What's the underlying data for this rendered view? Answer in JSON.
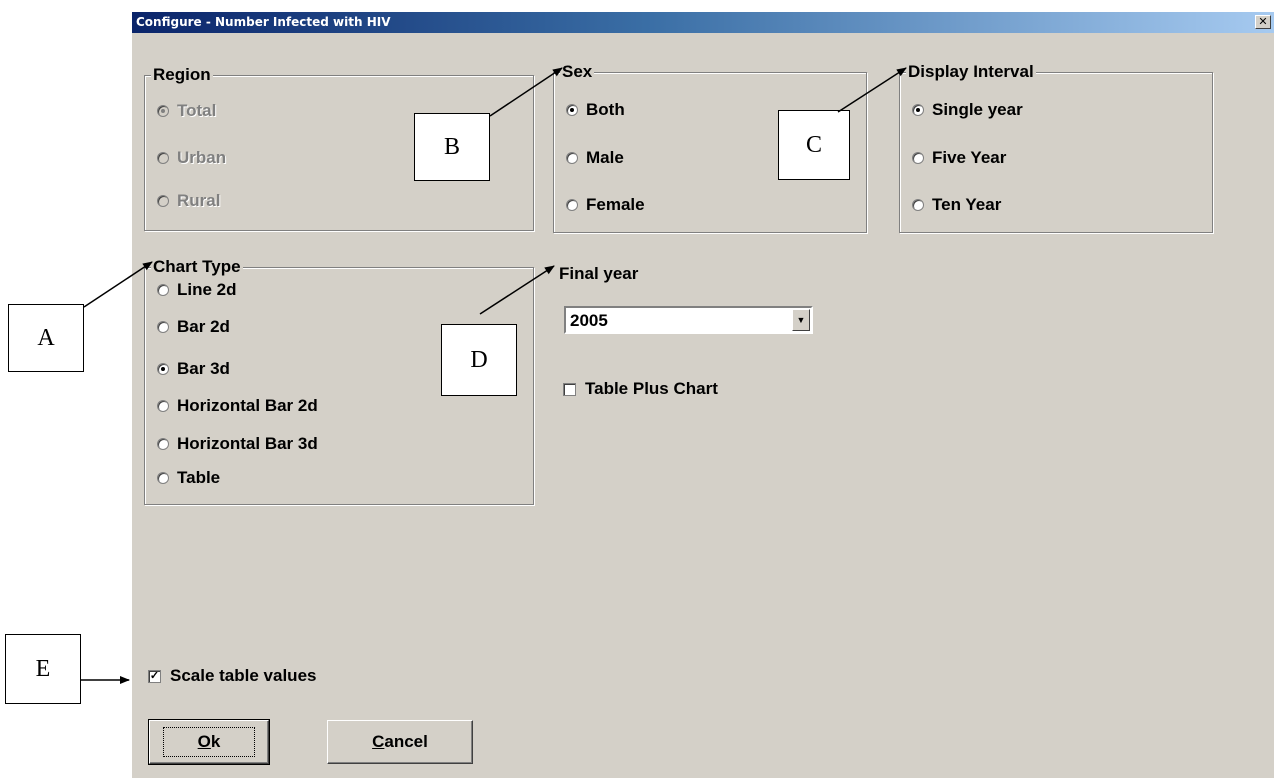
{
  "window": {
    "title": "Configure - Number Infected with HIV",
    "close_glyph": "✕"
  },
  "region": {
    "title": "Region",
    "options": [
      {
        "label": "Total",
        "checked": true,
        "disabled": true
      },
      {
        "label": "Urban",
        "checked": false,
        "disabled": true
      },
      {
        "label": "Rural",
        "checked": false,
        "disabled": true
      }
    ]
  },
  "sex": {
    "title": "Sex",
    "options": [
      {
        "label": "Both",
        "checked": true
      },
      {
        "label": "Male",
        "checked": false
      },
      {
        "label": "Female",
        "checked": false
      }
    ]
  },
  "display_interval": {
    "title": "Display Interval",
    "options": [
      {
        "label": "Single year",
        "checked": true
      },
      {
        "label": "Five Year",
        "checked": false
      },
      {
        "label": "Ten Year",
        "checked": false
      }
    ]
  },
  "chart_type": {
    "title": "Chart Type",
    "options": [
      {
        "label": "Line 2d",
        "checked": false
      },
      {
        "label": "Bar 2d",
        "checked": false
      },
      {
        "label": "Bar 3d",
        "checked": true
      },
      {
        "label": "Horizontal Bar 2d",
        "checked": false
      },
      {
        "label": "Horizontal Bar 3d",
        "checked": false
      },
      {
        "label": "Table",
        "checked": false
      }
    ]
  },
  "final_year": {
    "label": "Final year",
    "value": "2005",
    "dropdown_glyph": "▼"
  },
  "table_plus_chart": {
    "label": "Table Plus Chart",
    "checked": false
  },
  "scale_table_values": {
    "label": "Scale table values",
    "checked": true
  },
  "buttons": {
    "ok": {
      "mnemonic": "O",
      "rest": "k"
    },
    "cancel": {
      "mnemonic": "C",
      "rest": "ancel"
    }
  },
  "callouts": {
    "a": "A",
    "b": "B",
    "c": "C",
    "d": "D",
    "e": "E"
  }
}
